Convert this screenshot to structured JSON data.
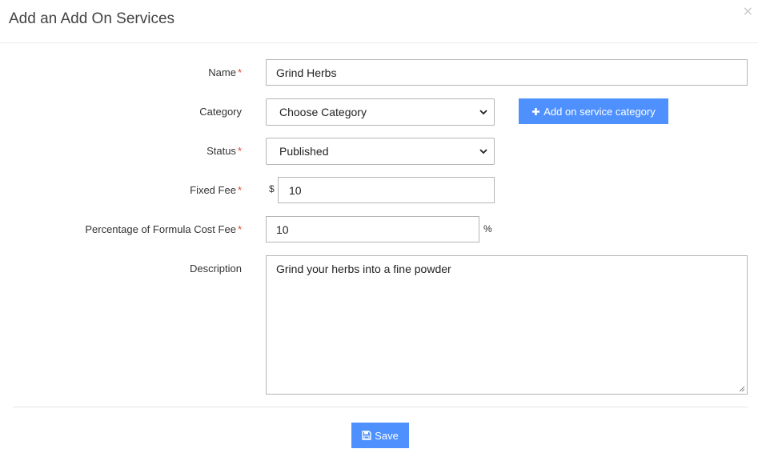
{
  "modal": {
    "title": "Add an Add On Services",
    "close_symbol": "×"
  },
  "form": {
    "required_marker": "*",
    "name": {
      "label": "Name",
      "value": "Grind Herbs"
    },
    "category": {
      "label": "Category",
      "selected": "Choose Category",
      "add_button_label": "Add on service category"
    },
    "status": {
      "label": "Status",
      "selected": "Published"
    },
    "fixed_fee": {
      "label": "Fixed Fee",
      "prefix": "$",
      "value": "10"
    },
    "percentage_fee": {
      "label": "Percentage of Formula Cost Fee",
      "value": "10",
      "suffix": "%"
    },
    "description": {
      "label": "Description",
      "value": "Grind your herbs into a fine powder"
    }
  },
  "footer": {
    "save_label": "Save"
  },
  "colors": {
    "primary": "#4d90fe",
    "required": "#e0452f"
  },
  "icons": {
    "close": "close-icon",
    "plus": "plus-icon",
    "save": "floppy-disk-icon",
    "dropdown": "chevron-down-icon"
  }
}
